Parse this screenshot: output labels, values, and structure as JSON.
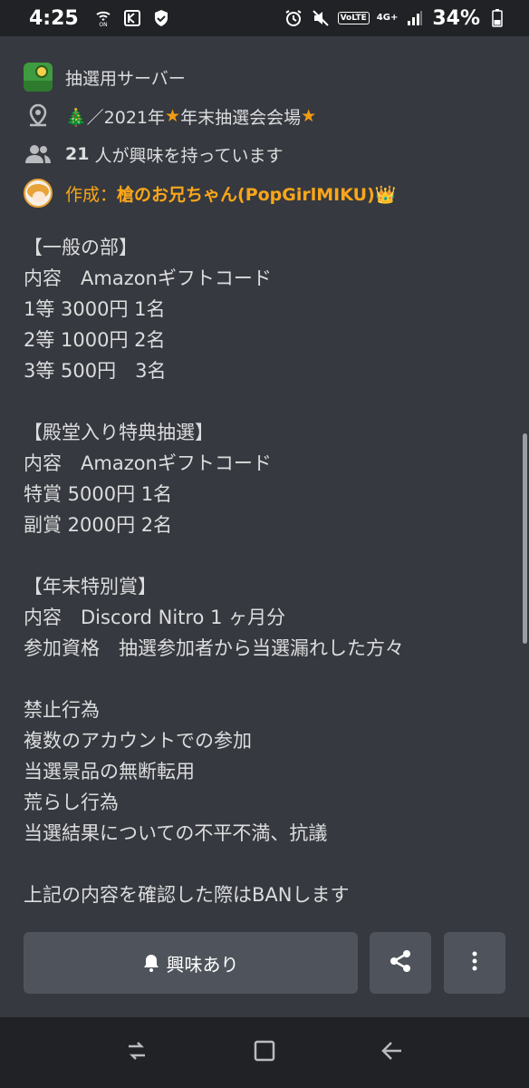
{
  "status_bar": {
    "time": "4:25",
    "volte_label": "VoLTE",
    "network_label": "4G+",
    "battery": "34%"
  },
  "event": {
    "server_name": "抽選用サーバー",
    "location_prefix": "🎄／2021年",
    "location_main": "年末抽選会会場",
    "star": "★",
    "interested_count": "21",
    "interested_suffix": "人が興味を持っています",
    "creator_prefix": "作成：",
    "creator_name": "槍のお兄ちゃん(PopGirlMIKU)👑"
  },
  "description_lines": [
    "【一般の部】",
    "内容　Amazonギフトコード",
    "1等 3000円 1名",
    "2等 1000円 2名",
    "3等 500円　3名",
    "",
    "【殿堂入り特典抽選】",
    "内容　Amazonギフトコード",
    "特賞 5000円 1名",
    "副賞 2000円 2名",
    "",
    "【年末特別賞】",
    "内容　Discord Nitro 1 ヶ月分",
    "参加資格　抽選参加者から当選漏れした方々",
    "",
    "禁止行為",
    "複数のアカウントでの参加",
    "当選景品の無断転用",
    "荒らし行為",
    "当選結果についての不平不満、抗議",
    "",
    "上記の内容を確認した際はBANします"
  ],
  "actions": {
    "interested_label": "興味あり"
  },
  "icons": {
    "location": "location-pin-icon",
    "people": "people-icon",
    "bell": "bell-icon",
    "share": "share-icon",
    "more": "more-vertical-icon"
  },
  "colors": {
    "background": "#36393f",
    "button": "#4f545c",
    "creator": "#faa61a",
    "star": "#f39c12"
  }
}
